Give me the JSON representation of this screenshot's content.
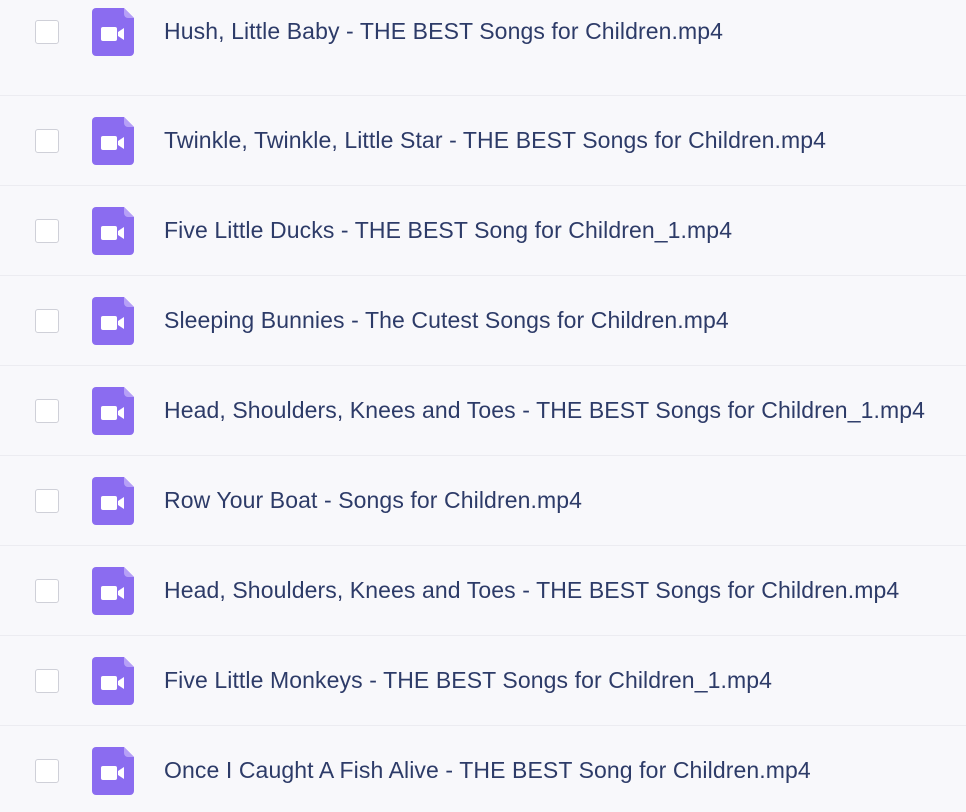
{
  "file_list": {
    "accent_color": "#8b6cf0",
    "files": [
      {
        "name": "Hush, Little Baby - THE BEST Songs for Children.mp4",
        "icon": "video-file-icon",
        "checked": false
      },
      {
        "name": "Twinkle, Twinkle, Little Star - THE BEST Songs for Children.mp4",
        "icon": "video-file-icon",
        "checked": false
      },
      {
        "name": "Five Little Ducks - THE BEST Song for Children_1.mp4",
        "icon": "video-file-icon",
        "checked": false
      },
      {
        "name": "Sleeping Bunnies - The Cutest Songs for Children.mp4",
        "icon": "video-file-icon",
        "checked": false
      },
      {
        "name": "Head, Shoulders, Knees and Toes - THE BEST Songs for Children_1.mp4",
        "icon": "video-file-icon",
        "checked": false
      },
      {
        "name": "Row Your Boat - Songs for Children.mp4",
        "icon": "video-file-icon",
        "checked": false
      },
      {
        "name": "Head, Shoulders, Knees and Toes - THE BEST Songs for Children.mp4",
        "icon": "video-file-icon",
        "checked": false
      },
      {
        "name": "Five Little Monkeys - THE BEST Songs for Children_1.mp4",
        "icon": "video-file-icon",
        "checked": false
      },
      {
        "name": "Once I Caught A Fish Alive - THE BEST Song for Children.mp4",
        "icon": "video-file-icon",
        "checked": false
      }
    ]
  }
}
